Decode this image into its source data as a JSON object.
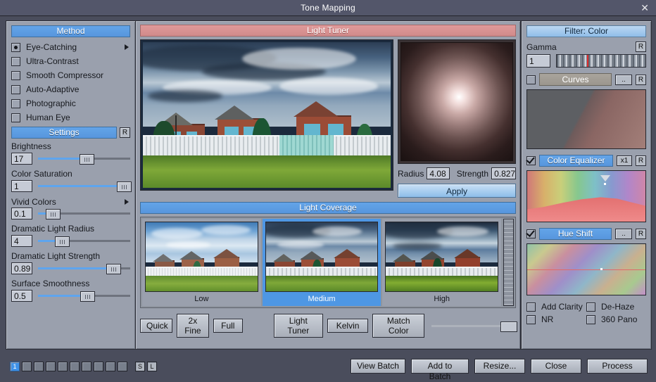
{
  "window": {
    "title": "Tone Mapping",
    "close_label": "✕"
  },
  "method": {
    "header": "Method",
    "items": [
      {
        "label": "Eye-Catching",
        "selected": true,
        "has_submenu": true
      },
      {
        "label": "Ultra-Contrast",
        "selected": false,
        "has_submenu": false
      },
      {
        "label": "Smooth Compressor",
        "selected": false,
        "has_submenu": false
      },
      {
        "label": "Auto-Adaptive",
        "selected": false,
        "has_submenu": false
      },
      {
        "label": "Photographic",
        "selected": false,
        "has_submenu": false
      },
      {
        "label": "Human Eye",
        "selected": false,
        "has_submenu": false
      }
    ]
  },
  "settings": {
    "header": "Settings",
    "reset_label": "R",
    "sliders": [
      {
        "label": "Brightness",
        "value": "17",
        "pct": 52,
        "submenu": false
      },
      {
        "label": "Color Saturation",
        "value": "1",
        "pct": 96,
        "submenu": false
      },
      {
        "label": "Vivid Colors",
        "value": "0.1",
        "pct": 10,
        "submenu": true
      },
      {
        "label": "Dramatic Light Radius",
        "value": "4",
        "pct": 23,
        "submenu": false
      },
      {
        "label": "Dramatic Light Strength",
        "value": "0.89",
        "pct": 83,
        "submenu": false
      },
      {
        "label": "Surface Smoothness",
        "value": "0.5",
        "pct": 53,
        "submenu": false
      }
    ]
  },
  "light_tuner": {
    "header": "Light Tuner",
    "radius_label": "Radius",
    "radius_value": "4.08",
    "strength_label": "Strength",
    "strength_value": "0.827",
    "apply_label": "Apply"
  },
  "light_coverage": {
    "header": "Light Coverage",
    "thumbs": [
      {
        "caption": "Low",
        "selected": false
      },
      {
        "caption": "Medium",
        "selected": true
      },
      {
        "caption": "High",
        "selected": false
      }
    ]
  },
  "toolbar": {
    "left_buttons": [
      "Quick",
      "2x Fine",
      "Full"
    ],
    "right_buttons": [
      "Light Tuner",
      "Kelvin",
      "Match Color"
    ],
    "slider_pct": 92
  },
  "filter": {
    "header": "Filter: Color",
    "gamma": {
      "label": "Gamma",
      "value": "1",
      "reset_label": "R",
      "marker_pct": 34
    },
    "curves": {
      "label": "Curves",
      "checked": false,
      "dots_label": "..",
      "reset_label": "R"
    },
    "color_equalizer": {
      "label": "Color Equalizer",
      "checked": true,
      "mult_label": "x1",
      "reset_label": "R",
      "marker_pct": 62
    },
    "hue_shift": {
      "label": "Hue Shift",
      "checked": true,
      "dots_label": "..",
      "reset_label": "R",
      "marker_pct": 62
    },
    "checks": [
      {
        "label": "Add Clarity",
        "checked": false
      },
      {
        "label": "De-Haze",
        "checked": false
      },
      {
        "label": "NR",
        "checked": false
      },
      {
        "label": "360 Pano",
        "checked": false
      }
    ]
  },
  "footer": {
    "pages": [
      "1",
      "",
      "",
      "",
      "",
      "",
      "",
      "",
      "",
      ""
    ],
    "active_page_index": 0,
    "small_buttons": [
      "S",
      "L"
    ],
    "buttons": [
      "View Batch",
      "Add to Batch",
      "Resize...",
      "Close",
      "Process"
    ]
  },
  "colors": {
    "accent_blue": "#5b9bdd",
    "header_red": "#d89494",
    "window_bg": "#4a4d5c",
    "panel_bg": "#9aa0ad"
  }
}
